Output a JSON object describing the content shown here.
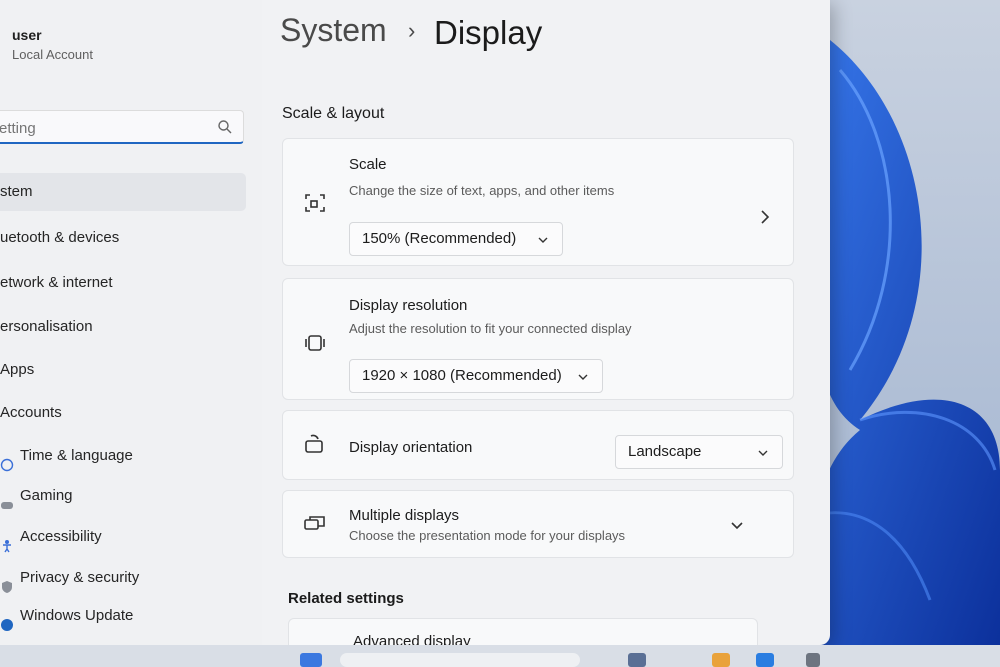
{
  "user": {
    "name": "user",
    "type": "Local Account"
  },
  "search": {
    "placeholder": "etting"
  },
  "nav": [
    {
      "label": "stem",
      "icon": "system-icon",
      "selected": true
    },
    {
      "label": "uetooth & devices",
      "icon": "bluetooth-icon",
      "selected": false
    },
    {
      "label": "etwork & internet",
      "icon": "network-icon",
      "selected": false
    },
    {
      "label": "ersonalisation",
      "icon": "brush-icon",
      "selected": false
    },
    {
      "label": "Apps",
      "icon": "apps-icon",
      "selected": false
    },
    {
      "label": "Accounts",
      "icon": "person-icon",
      "selected": false
    },
    {
      "label": "Time & language",
      "icon": "clock-icon",
      "selected": false
    },
    {
      "label": "Gaming",
      "icon": "gamepad-icon",
      "selected": false
    },
    {
      "label": "Accessibility",
      "icon": "accessibility-icon",
      "selected": false
    },
    {
      "label": "Privacy & security",
      "icon": "shield-icon",
      "selected": false
    },
    {
      "label": "Windows Update",
      "icon": "update-icon",
      "selected": false
    }
  ],
  "breadcrumb": {
    "parent": "System",
    "separator": "›",
    "current": "Display"
  },
  "scale_layout": {
    "title": "Scale & layout",
    "scale": {
      "title": "Scale",
      "description": "Change the size of text, apps, and other items",
      "value": "150% (Recommended)"
    },
    "resolution": {
      "title": "Display resolution",
      "description": "Adjust the resolution to fit your connected display",
      "value": "1920 × 1080 (Recommended)"
    },
    "orientation": {
      "title": "Display orientation",
      "value": "Landscape"
    },
    "multiple": {
      "title": "Multiple displays",
      "description": "Choose the presentation mode for your displays"
    }
  },
  "related": {
    "title": "Related settings",
    "advanced_display": "Advanced display"
  },
  "colors": {
    "accent": "#1f66c1",
    "window_bg": "#f1f2f4",
    "card_bg": "#f8f9fa"
  }
}
